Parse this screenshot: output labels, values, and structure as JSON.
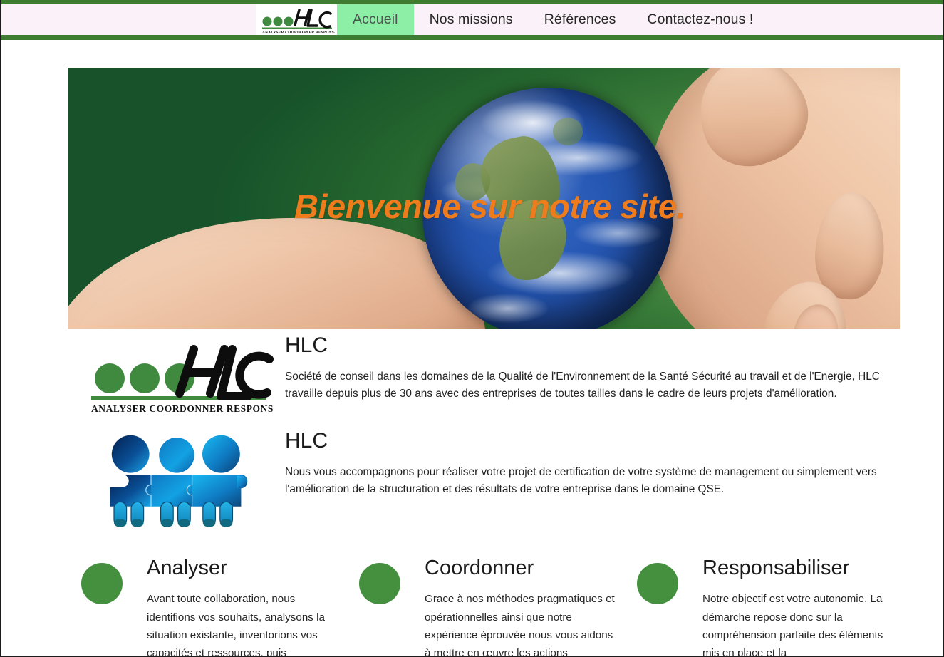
{
  "site": {
    "brand_name": "HLC",
    "brand_tagline": "ANALYSER COORDONNER RESPONSABILISER"
  },
  "nav": {
    "items": [
      {
        "label": "Accueil",
        "active": true
      },
      {
        "label": "Nos missions",
        "active": false
      },
      {
        "label": "Références",
        "active": false
      },
      {
        "label": "Contactez-nous !",
        "active": false
      }
    ]
  },
  "hero": {
    "headline": "Bienvenue sur notre site.",
    "headline_color": "#ef7c1c",
    "background_color": "#1e5c2c",
    "image_alt": "hand-holding-earth"
  },
  "intro": [
    {
      "media": "hlc-logo",
      "heading": "HLC",
      "paragraph": "Société de conseil dans les domaines de la Qualité de l'Environnement de la Santé Sécurité au travail et de l'Energie, HLC travaille depuis plus de 30 ans avec des entreprises de toutes tailles dans le cadre de leurs projets d'amélioration."
    },
    {
      "media": "puzzle-people",
      "heading": "HLC",
      "paragraph": "Nous vous accompagnons pour réaliser votre projet de certification de votre système de management ou simplement vers l'amélioration de la structuration et des résultats de votre entreprise dans le domaine QSE."
    }
  ],
  "columns": [
    {
      "heading": "Analyser",
      "paragraph": "Avant toute collaboration, nous identifions vos souhaits, analysons la situation existante, inventorions vos capacités et ressources, puis"
    },
    {
      "heading": "Coordonner",
      "paragraph": "Grace à nos méthodes pragmatiques et opérationnelles ainsi que notre expérience éprouvée nous vous aidons à mettre en œuvre les actions"
    },
    {
      "heading": "Responsabiliser",
      "paragraph": "Notre objectif est votre autonomie. La démarche repose donc sur la compréhension parfaite des éléments mis en place et la"
    }
  ],
  "theme": {
    "accent_green": "#45903f",
    "border_green": "#3e7c31",
    "nav_active_green": "#8cefa5",
    "nav_background": "#faf2f8",
    "orange": "#ef7c1c"
  }
}
